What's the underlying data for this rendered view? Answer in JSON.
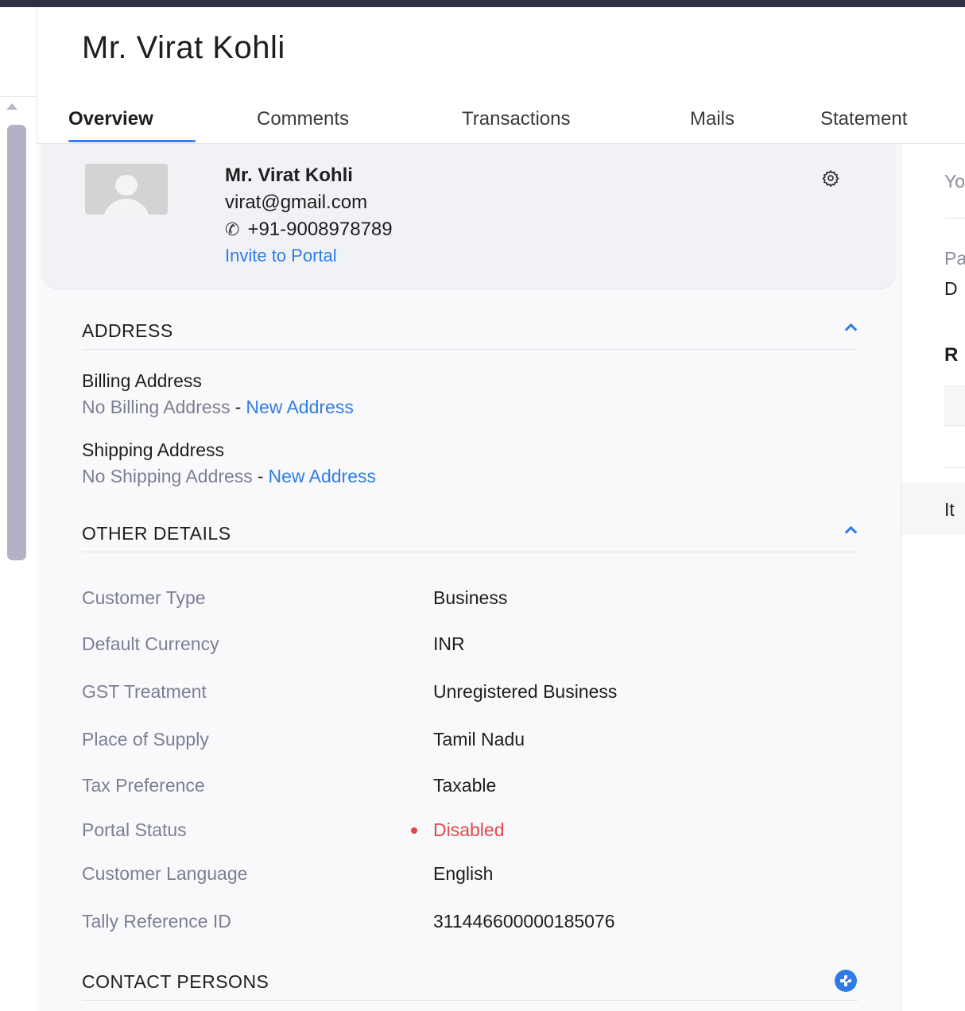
{
  "page": {
    "title": "Mr. Virat Kohli"
  },
  "tabs": [
    {
      "label": "Overview",
      "active": true
    },
    {
      "label": "Comments",
      "active": false
    },
    {
      "label": "Transactions",
      "active": false
    },
    {
      "label": "Mails",
      "active": false
    },
    {
      "label": "Statement",
      "active": false
    }
  ],
  "profile": {
    "name": "Mr. Virat Kohli",
    "email": "virat@gmail.com",
    "phone_icon": "phone-icon",
    "phone": "+91-9008978789",
    "invite_link": "Invite to Portal",
    "settings_icon": "gear-icon"
  },
  "address": {
    "section_title": "ADDRESS",
    "billing": {
      "label": "Billing Address",
      "empty_text": "No Billing Address",
      "separator": "-",
      "link": "New Address"
    },
    "shipping": {
      "label": "Shipping Address",
      "empty_text": "No Shipping Address",
      "separator": "-",
      "link": "New Address"
    }
  },
  "other_details": {
    "section_title": "OTHER DETAILS",
    "rows": [
      {
        "label": "Customer Type",
        "value": "Business"
      },
      {
        "label": "Default Currency",
        "value": "INR"
      },
      {
        "label": "GST Treatment",
        "value": "Unregistered Business"
      },
      {
        "label": "Place of Supply",
        "value": "Tamil Nadu"
      },
      {
        "label": "Tax Preference",
        "value": "Taxable"
      },
      {
        "label": "Portal Status",
        "value": "Disabled",
        "status_color": "#e0474c"
      },
      {
        "label": "Customer Language",
        "value": "English"
      },
      {
        "label": "Tally Reference ID",
        "value": "311446600000185076"
      }
    ]
  },
  "contact_persons": {
    "section_title": "CONTACT PERSONS",
    "add_icon": "plus-circle-icon"
  },
  "right_peek": {
    "line1": "Yo",
    "line2": "Pa",
    "line3": "D",
    "line4": "R",
    "line5": "It"
  },
  "colors": {
    "accent": "#2f7ce8",
    "topbar": "#2e3046",
    "muted_label": "#7b7f93",
    "danger": "#e0474c"
  }
}
